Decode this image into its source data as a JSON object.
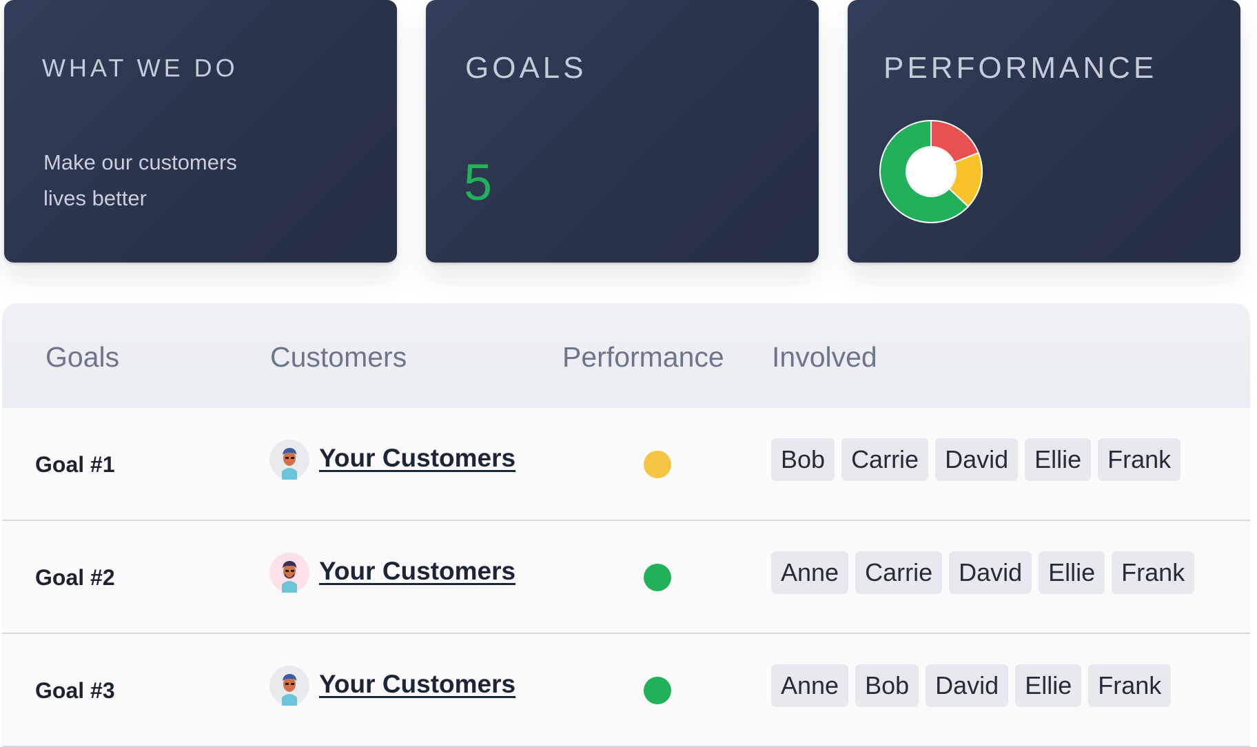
{
  "cards": {
    "mission": {
      "title": "What we do",
      "text": "Make our customers lives better"
    },
    "goals": {
      "title": "Goals",
      "count": "5"
    },
    "performance": {
      "title": "Performance",
      "donut": [
        {
          "status": "at-risk",
          "color": "#e84f4f",
          "fraction": 0.19
        },
        {
          "status": "delayed",
          "color": "#f8c22a",
          "fraction": 0.18
        },
        {
          "status": "on-track",
          "color": "#22b05a",
          "fraction": 0.63
        }
      ]
    }
  },
  "table": {
    "headers": {
      "goals": "Goals",
      "customers": "Customers",
      "performance": "Performance",
      "involved": "Involved"
    },
    "rows": [
      {
        "goal": "Goal #1",
        "customer": "Your Customers",
        "avatar": "customer-avatar-orange",
        "status_color": "#f4c542",
        "people": [
          "Bob",
          "Carrie",
          "David",
          "Ellie",
          "Frank"
        ]
      },
      {
        "goal": "Goal #2",
        "customer": "Your Customers",
        "avatar": "customer-avatar-pink",
        "status_color": "#22b05a",
        "people": [
          "Anne",
          "Carrie",
          "David",
          "Ellie",
          "Frank"
        ]
      },
      {
        "goal": "Goal #3",
        "customer": "Your Customers",
        "avatar": "customer-avatar-orange",
        "status_color": "#22b05a",
        "people": [
          "Anne",
          "Bob",
          "David",
          "Ellie",
          "Frank"
        ]
      }
    ]
  }
}
